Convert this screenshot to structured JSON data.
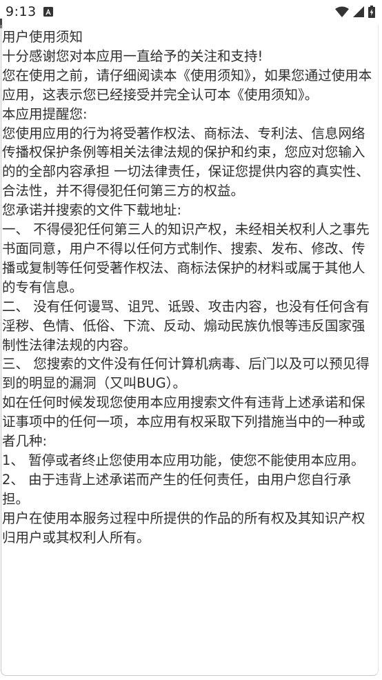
{
  "status_bar": {
    "time": "9:13",
    "notification_icon": "a-notification-icon",
    "wifi_icon": "wifi-icon",
    "signal_icon": "cell-signal-icon",
    "battery_icon": "battery-charging-icon"
  },
  "notice": {
    "title": "用户使用须知",
    "paragraphs": [
      "十分感谢您对本应用一直给予的关注和支持!",
      "您在使用之前，请仔细阅读本《使用须知》，如果您通过使用本应用，这表示您已经接受并完全认可本《使用须知》。",
      "本应用提醒您:",
      "您使用应用的行为将受著作权法、商标法、专利法、信息网络传播权保护条例等相关法律法规的保护和约束，您应对您输入的的全部内容承担 一切法律责任，保证您提供内容的真实性、合法性，并不得侵犯任何第三方的权益。",
      "您承诺并搜索的文件下载地址:",
      "一、 不得侵犯任何第三人的知识产权，未经相关权利人之事先书面同意，用户不得以任何方式制作、搜索、发布、修改、传播或复制等任何受著作权法、商标法保护的材料或属于其他人的专有信息。",
      "二、 没有任何谩骂、诅咒、诋毁、攻击内容，也没有任何含有淫秽、色情、低俗、下流、反动、煽动民族仇恨等违反国家强制性法律法规的内容。",
      "三、 您搜索的文件没有任何计算机病毒、后门以及可以预见得到的明显的漏洞（又叫BUG）。",
      "如在任何时候发现您使用本应用搜索文件有违背上述承诺和保证事项中的任何一项，本应用有权采取下列措施当中的一种或者几种:",
      "1、 暂停或者终止您使用本应用功能，使您不能使用本应用。",
      "2、 由于违背上述承诺而产生的任何责任，由用户您自行承担。",
      "用户在使用本服务过程中所提供的作品的所有权及其知识产权归用户或其权利人所有。"
    ]
  }
}
